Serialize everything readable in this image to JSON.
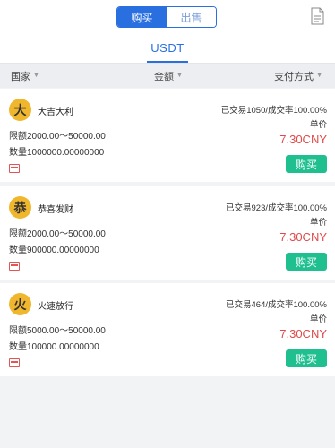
{
  "segments": {
    "buy_label": "购买",
    "sell_label": "出售"
  },
  "tab": {
    "label": "USDT"
  },
  "header": {
    "country": "国家",
    "amount": "金额",
    "payment": "支付方式"
  },
  "colors": {
    "accent": "#2a6fe0",
    "buy": "#1fbf8f",
    "price": "#e04a4a",
    "avatar": "#f0b62c"
  },
  "icons": {
    "top_right": "document-icon",
    "payment": "bank-card-icon"
  },
  "listings": [
    {
      "avatar": "大",
      "name": "大吉大利",
      "stats": "已交易1050/成交率100.00%",
      "unit_label": "单价",
      "limit": "限额2000.00～50000.00",
      "quantity": "数量1000000.00000000",
      "price": "7.30CNY",
      "buy_label": "购买"
    },
    {
      "avatar": "恭",
      "name": "恭喜发财",
      "stats": "已交易923/成交率100.00%",
      "unit_label": "单价",
      "limit": "限额2000.00～50000.00",
      "quantity": "数量900000.00000000",
      "price": "7.30CNY",
      "buy_label": "购买"
    },
    {
      "avatar": "火",
      "name": "火速放行",
      "stats": "已交易464/成交率100.00%",
      "unit_label": "单价",
      "limit": "限额5000.00～50000.00",
      "quantity": "数量100000.00000000",
      "price": "7.30CNY",
      "buy_label": "购买"
    }
  ]
}
